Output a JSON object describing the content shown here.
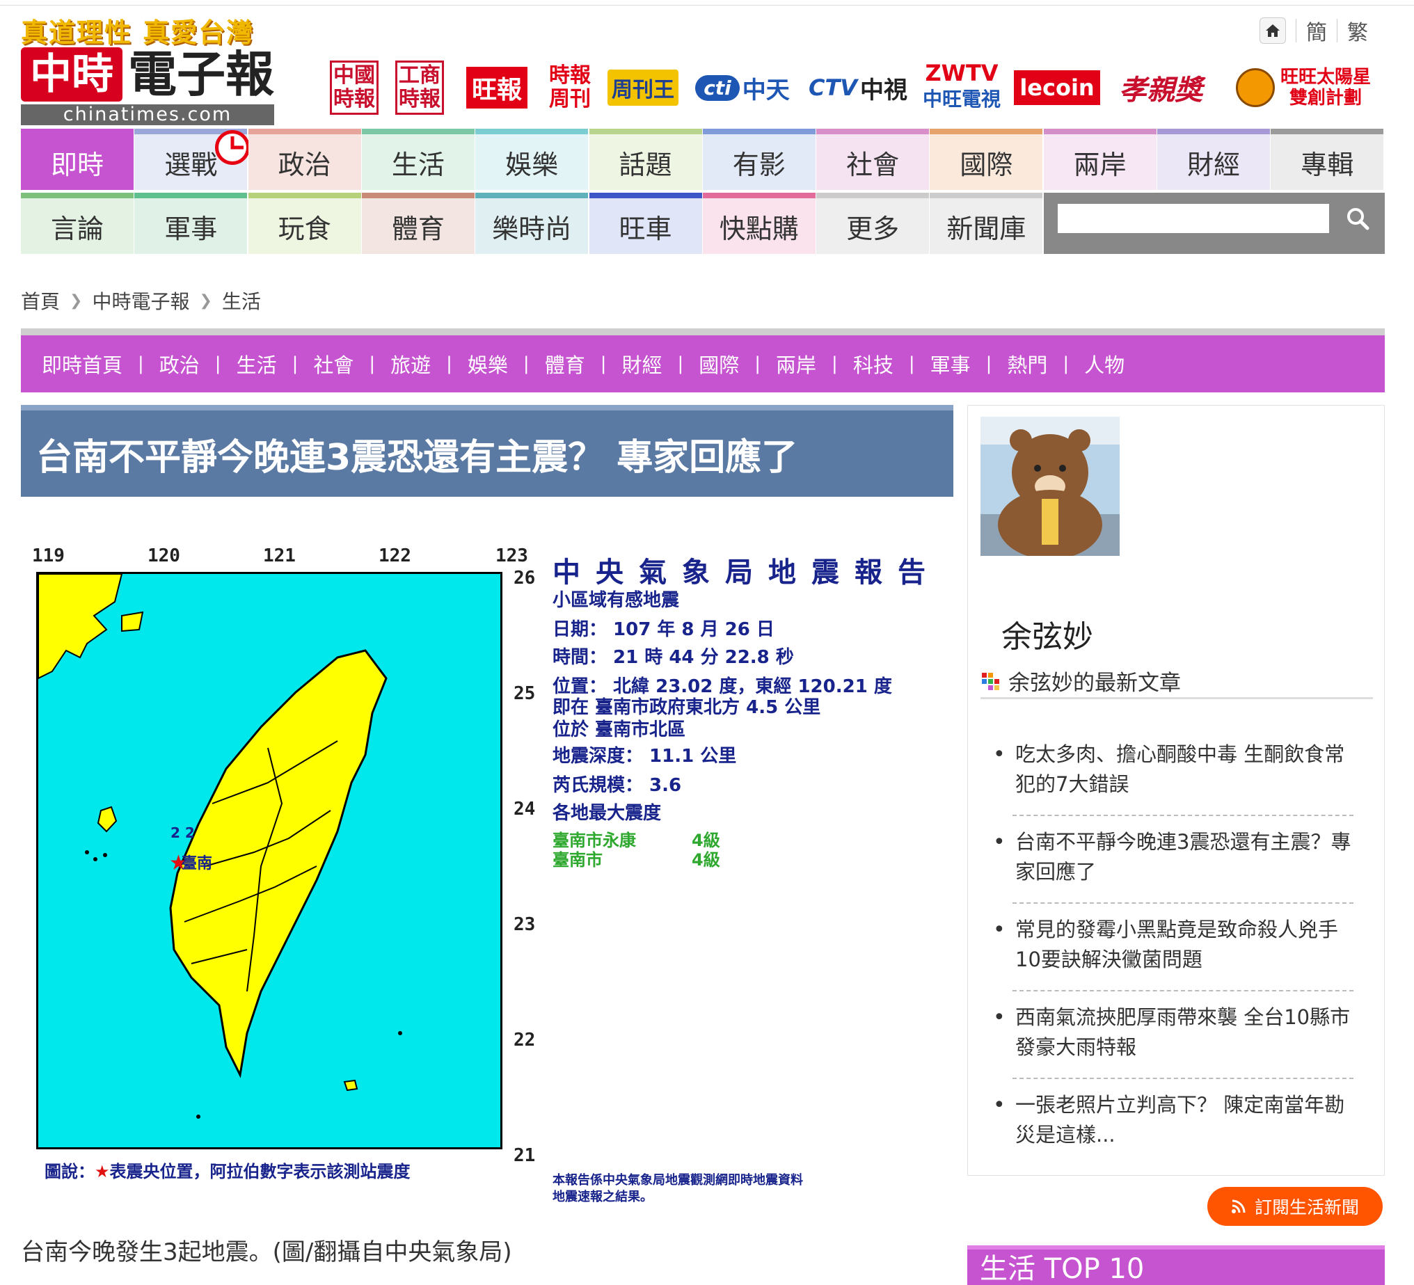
{
  "header": {
    "slogan": "真道理性  真愛台灣",
    "logo_mark": "中時",
    "logo_text": "電子報",
    "logo_domain": "chinatimes.com",
    "partners": [
      {
        "line1": "中國",
        "line2": "時報"
      },
      {
        "line1": "工商",
        "line2": "時報"
      },
      {
        "label": "旺報"
      },
      {
        "line1": "時報",
        "line2": "周刊"
      },
      {
        "label": "周刊王"
      },
      {
        "mark": "cti",
        "label": "中天"
      },
      {
        "mark": "CTV",
        "label": "中視"
      },
      {
        "line1": "ZWTV",
        "line2": "中旺電視"
      },
      {
        "label": "lecoin"
      },
      {
        "label": "孝親獎"
      },
      {
        "line1": "旺旺太陽星",
        "line2": "雙創計劃"
      }
    ],
    "lang_simplified": "簡",
    "lang_traditional": "繁"
  },
  "nav": {
    "row1": [
      {
        "label": "即時",
        "color": "#c653cf",
        "bg": "#c653cf"
      },
      {
        "label": "選戰",
        "color": "#9aa7d8",
        "bg": "#e6ebf7"
      },
      {
        "label": "政治",
        "color": "#e6a49a",
        "bg": "#f7e4e0"
      },
      {
        "label": "生活",
        "color": "#7cc7a5",
        "bg": "#e2f3ea"
      },
      {
        "label": "娛樂",
        "color": "#7ccdd2",
        "bg": "#e2f4f5"
      },
      {
        "label": "話題",
        "color": "#b9d58d",
        "bg": "#eef5e2"
      },
      {
        "label": "有影",
        "color": "#7f9bd9",
        "bg": "#e2e9f7"
      },
      {
        "label": "社會",
        "color": "#d88ec9",
        "bg": "#f5e3f1"
      },
      {
        "label": "國際",
        "color": "#e7a36c",
        "bg": "#fbe9dc"
      },
      {
        "label": "兩岸",
        "color": "#d58fc8",
        "bg": "#f7e6f3"
      },
      {
        "label": "財經",
        "color": "#a699d6",
        "bg": "#ebe7f6"
      },
      {
        "label": "專輯",
        "color": "#9b9b9b",
        "bg": "#ececec"
      }
    ],
    "row2": [
      {
        "label": "言論",
        "color": "#7cc07b",
        "bg": "#e3f2e3"
      },
      {
        "label": "軍事",
        "color": "#5fbf8f",
        "bg": "#e0f2e8"
      },
      {
        "label": "玩食",
        "color": "#b5d27a",
        "bg": "#eef5e0"
      },
      {
        "label": "體育",
        "color": "#c98b78",
        "bg": "#f3e5e1"
      },
      {
        "label": "樂時尚",
        "color": "#5fb2b9",
        "bg": "#e0f0f2"
      },
      {
        "label": "旺車",
        "color": "#3d57c8",
        "bg": "#e0e5f7"
      },
      {
        "label": "快點購",
        "color": "#e36b9c",
        "bg": "#fbe3ee"
      },
      {
        "label": "更多",
        "color": "#cccccc",
        "bg": "#eeeeee"
      },
      {
        "label": "新聞庫",
        "color": "#cccccc",
        "bg": "#eeeeee"
      }
    ],
    "search_placeholder": ""
  },
  "breadcrumb": [
    "首頁",
    "中時電子報",
    "生活"
  ],
  "subnav": [
    "即時首頁",
    "政治",
    "生活",
    "社會",
    "旅遊",
    "娛樂",
    "體育",
    "財經",
    "國際",
    "兩岸",
    "科技",
    "軍事",
    "熱門",
    "人物"
  ],
  "article": {
    "headline": "台南不平靜今晚連3震恐還有主震？  專家回應了",
    "caption": "台南今晚發生3起地震。(圖/翻攝自中央氣象局)"
  },
  "quake_report": {
    "lon_ticks": [
      "119",
      "120",
      "121",
      "122",
      "123"
    ],
    "lat_ticks": [
      "26",
      "25",
      "24",
      "23",
      "22",
      "21"
    ],
    "title": "中央氣象局地震報告",
    "lines": [
      "小區域有感地震",
      "日期： 107 年 8 月 26 日",
      "時間： 21 時 44 分 22.8 秒",
      "位置： 北緯 23.02 度，東經 120.21 度",
      "即在 臺南市政府東北方 4.5 公里",
      "位於 臺南市北區",
      "地震深度： 11.1 公里",
      "芮氏規模： 3.6",
      "各地最大震度"
    ],
    "intensities": [
      {
        "place": "臺南市永康",
        "level": "4級"
      },
      {
        "place": "臺南市",
        "level": "4級"
      }
    ],
    "map_label": "臺南",
    "station_marks": "2 2",
    "legend_prefix": "圖說：",
    "legend_star": "★",
    "legend_text": "表震央位置，阿拉伯數字表示該測站震度",
    "note_line1": "本報告係中央氣象局地震觀測網即時地震資料",
    "note_line2": "地震速報之結果。"
  },
  "sidebar": {
    "author": "余弦妙",
    "latest_label": "余弦妙的最新文章",
    "articles": [
      "吃太多肉、擔心酮酸中毒 生酮飲食常犯的7大錯誤",
      "台南不平靜今晚連3震恐還有主震？專家回應了",
      "常見的發霉小黑點竟是致命殺人兇手 10要訣解決黴菌問題",
      "西南氣流挾肥厚雨帶來襲 全台10縣市發豪大雨特報",
      "一張老照片立判高下？ 陳定南當年勘災是這樣..."
    ],
    "subscribe_label": "訂閱生活新聞",
    "top10_label": "生活 TOP 10"
  },
  "colors": {
    "accent_purple": "#c653cf",
    "headline_blue": "#5b7aa3",
    "map_sea": "#00e8ec",
    "map_land": "#ffff00",
    "subscribe_orange": "#ff5500"
  }
}
